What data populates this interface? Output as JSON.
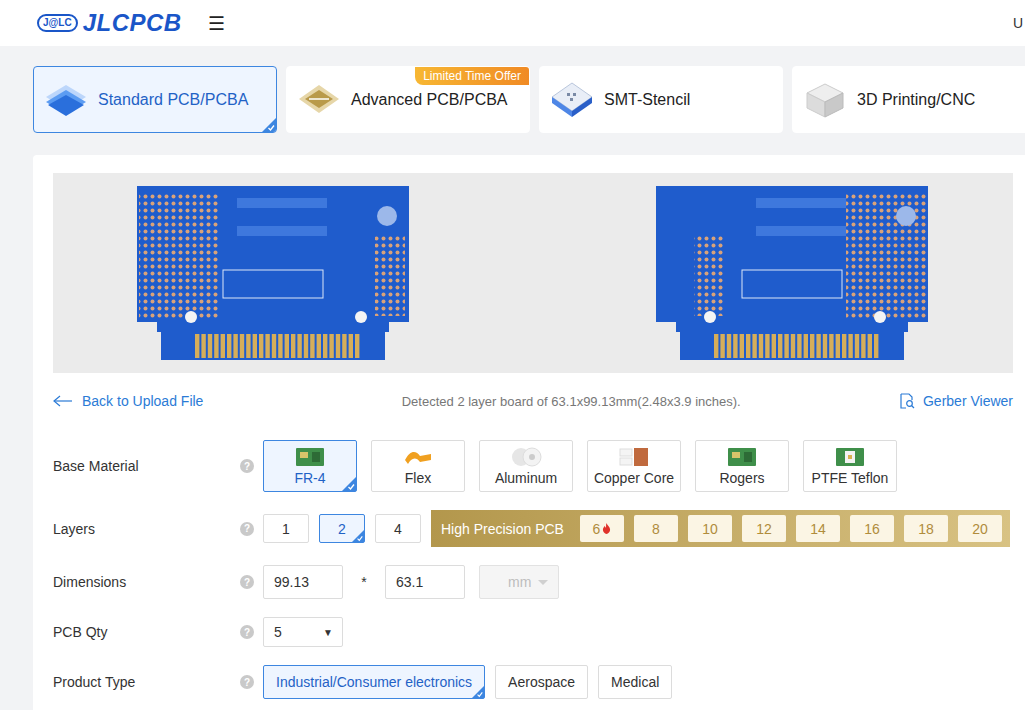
{
  "header": {
    "logo_badge": "J@LC",
    "logo_text": "JLCPCB",
    "menu_icon": "☰",
    "user": "U"
  },
  "tabs": [
    {
      "label": "Standard PCB/PCBA",
      "kind": "standard",
      "selected": true
    },
    {
      "label": "Advanced PCB/PCBA",
      "kind": "advanced",
      "selected": false,
      "badge": "Limited Time Offer"
    },
    {
      "label": "SMT-Stencil",
      "kind": "stencil",
      "selected": false
    },
    {
      "label": "3D Printing/CNC",
      "kind": "printing",
      "selected": false
    }
  ],
  "toolbar": {
    "back": "Back to Upload File",
    "detected": "Detected 2 layer board of 63.1x99.13mm(2.48x3.9 inches).",
    "gerber": "Gerber Viewer"
  },
  "form": {
    "base_material": {
      "label": "Base Material",
      "help": "?",
      "options": [
        {
          "label": "FR-4",
          "kind": "fr4",
          "selected": true
        },
        {
          "label": "Flex",
          "kind": "flex",
          "selected": false
        },
        {
          "label": "Aluminum",
          "kind": "aluminum",
          "selected": false
        },
        {
          "label": "Copper Core",
          "kind": "copper",
          "selected": false
        },
        {
          "label": "Rogers",
          "kind": "rogers",
          "selected": false
        },
        {
          "label": "PTFE Teflon",
          "kind": "ptfe",
          "selected": false
        }
      ]
    },
    "layers": {
      "label": "Layers",
      "help": "?",
      "options": [
        {
          "label": "1",
          "selected": false
        },
        {
          "label": "2",
          "selected": true
        },
        {
          "label": "4",
          "selected": false
        }
      ],
      "high_precision": {
        "label": "High Precision PCB",
        "options": [
          {
            "label": "6",
            "hot": true,
            "selected": false
          },
          {
            "label": "8",
            "hot": false,
            "selected": false
          },
          {
            "label": "10",
            "hot": false,
            "selected": false
          },
          {
            "label": "12",
            "hot": false,
            "selected": false
          },
          {
            "label": "14",
            "hot": false,
            "selected": false
          },
          {
            "label": "16",
            "hot": false,
            "selected": false
          },
          {
            "label": "18",
            "hot": false,
            "selected": false
          },
          {
            "label": "20",
            "hot": false,
            "selected": false
          }
        ]
      }
    },
    "dimensions": {
      "label": "Dimensions",
      "help": "?",
      "width": "99.13",
      "separator": "*",
      "height": "63.1",
      "unit": "mm",
      "unit_disabled": true
    },
    "pcb_qty": {
      "label": "PCB Qty",
      "help": "?",
      "value": "5",
      "arrow": "▼"
    },
    "product_type": {
      "label": "Product Type",
      "help": "?",
      "options": [
        {
          "label": "Industrial/Consumer electronics",
          "selected": true
        },
        {
          "label": "Aerospace",
          "selected": false
        },
        {
          "label": "Medical",
          "selected": false
        }
      ]
    }
  }
}
